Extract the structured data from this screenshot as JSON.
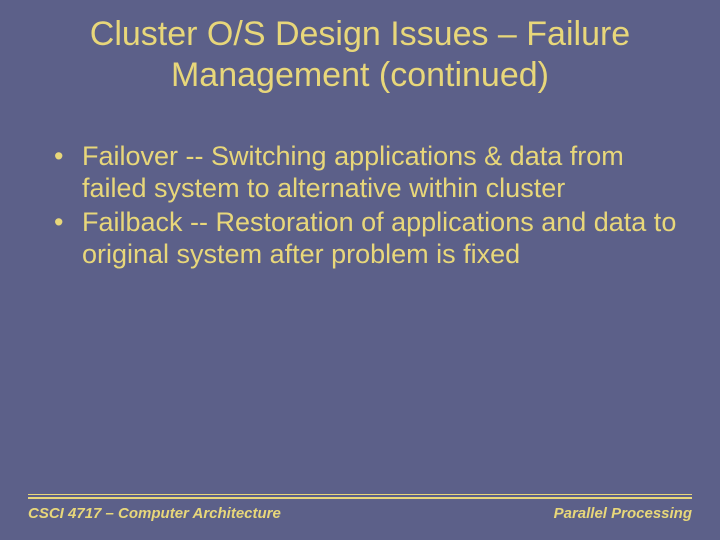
{
  "title": "Cluster O/S Design Issues – Failure Management (continued)",
  "bullets": [
    "Failover -- Switching applications & data from failed system to alternative within cluster",
    "Failback -- Restoration of applications and data to original system after problem is fixed"
  ],
  "footer": {
    "left": "CSCI 4717 – Computer Architecture",
    "right": "Parallel Processing"
  }
}
